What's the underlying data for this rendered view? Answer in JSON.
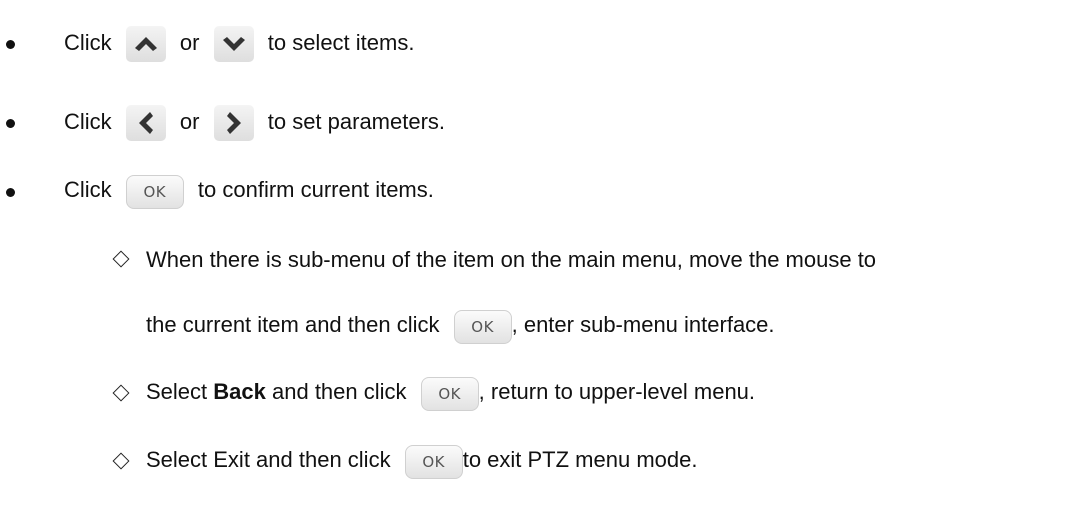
{
  "bullets": [
    {
      "pre": "Click",
      "mid": "or",
      "post": "to select items.",
      "icon1": "up-arrow-icon",
      "icon2": "down-arrow-icon"
    },
    {
      "pre": "Click",
      "mid": "or",
      "post": "to set parameters.",
      "icon1": "left-arrow-icon",
      "icon2": "right-arrow-icon"
    },
    {
      "pre": "Click",
      "ok": "OK",
      "post": "to confirm current items."
    }
  ],
  "subitems": [
    {
      "line1": "When there is sub-menu of the item on the main menu, move the mouse to",
      "line2_pre": "the current item and then click",
      "ok": "OK",
      "line2_post": ", enter sub-menu interface."
    },
    {
      "pre": "Select",
      "bold": "Back",
      "mid": "and then click",
      "ok": "OK",
      "post": ", return to upper-level menu."
    },
    {
      "pre": "Select Exit and then click",
      "ok": "OK",
      "post": "to exit PTZ menu mode."
    }
  ],
  "colors": {
    "text": "#111111",
    "arrow": "#333333",
    "button_bg": "#e8e8e8",
    "ok_text": "#555555"
  }
}
